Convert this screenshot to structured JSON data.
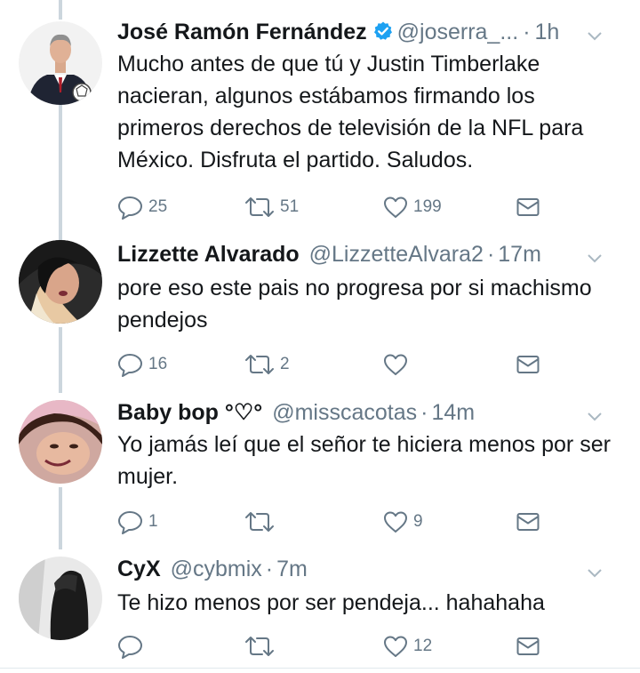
{
  "tweets": [
    {
      "name": "José Ramón Fernández",
      "verified": true,
      "handle": "@joserra_...",
      "time": "1h",
      "text": "Mucho antes de que tú y Justin Timberlake nacieran, algunos estábamos firmando los primeros derechos de televisión de la NFL para México. Disfruta el partido. Saludos.",
      "replies": "25",
      "retweets": "51",
      "likes": "199"
    },
    {
      "name": "Lizzette Alvarado",
      "verified": false,
      "handle": "@LizzetteAlvara2",
      "time": "17m",
      "text": "pore eso este pais no progresa por si machismo pendejos",
      "replies": "16",
      "retweets": "2",
      "likes": ""
    },
    {
      "name": "Baby bop °♡°",
      "verified": false,
      "handle": "@misscacotas",
      "time": "14m",
      "text": "Yo jamás leí que el señor te hiciera menos por ser mujer.",
      "replies": "1",
      "retweets": "",
      "likes": "9"
    },
    {
      "name": "CyX",
      "verified": false,
      "handle": "@cybmix",
      "time": "7m",
      "text": "Te hizo menos por ser pendeja... hahahaha",
      "replies": "",
      "retweets": "",
      "likes": "12"
    }
  ],
  "separator": "·",
  "icons": {
    "reply": "reply-icon",
    "retweet": "retweet-icon",
    "like": "heart-icon",
    "message": "envelope-icon",
    "more": "chevron-down-icon",
    "verified": "verified-badge-icon"
  },
  "colors": {
    "name": "#14171a",
    "secondary": "#657786",
    "verified": "#1da1f2",
    "thread_line": "#ccd6dd",
    "divider": "#e1e8ed"
  }
}
